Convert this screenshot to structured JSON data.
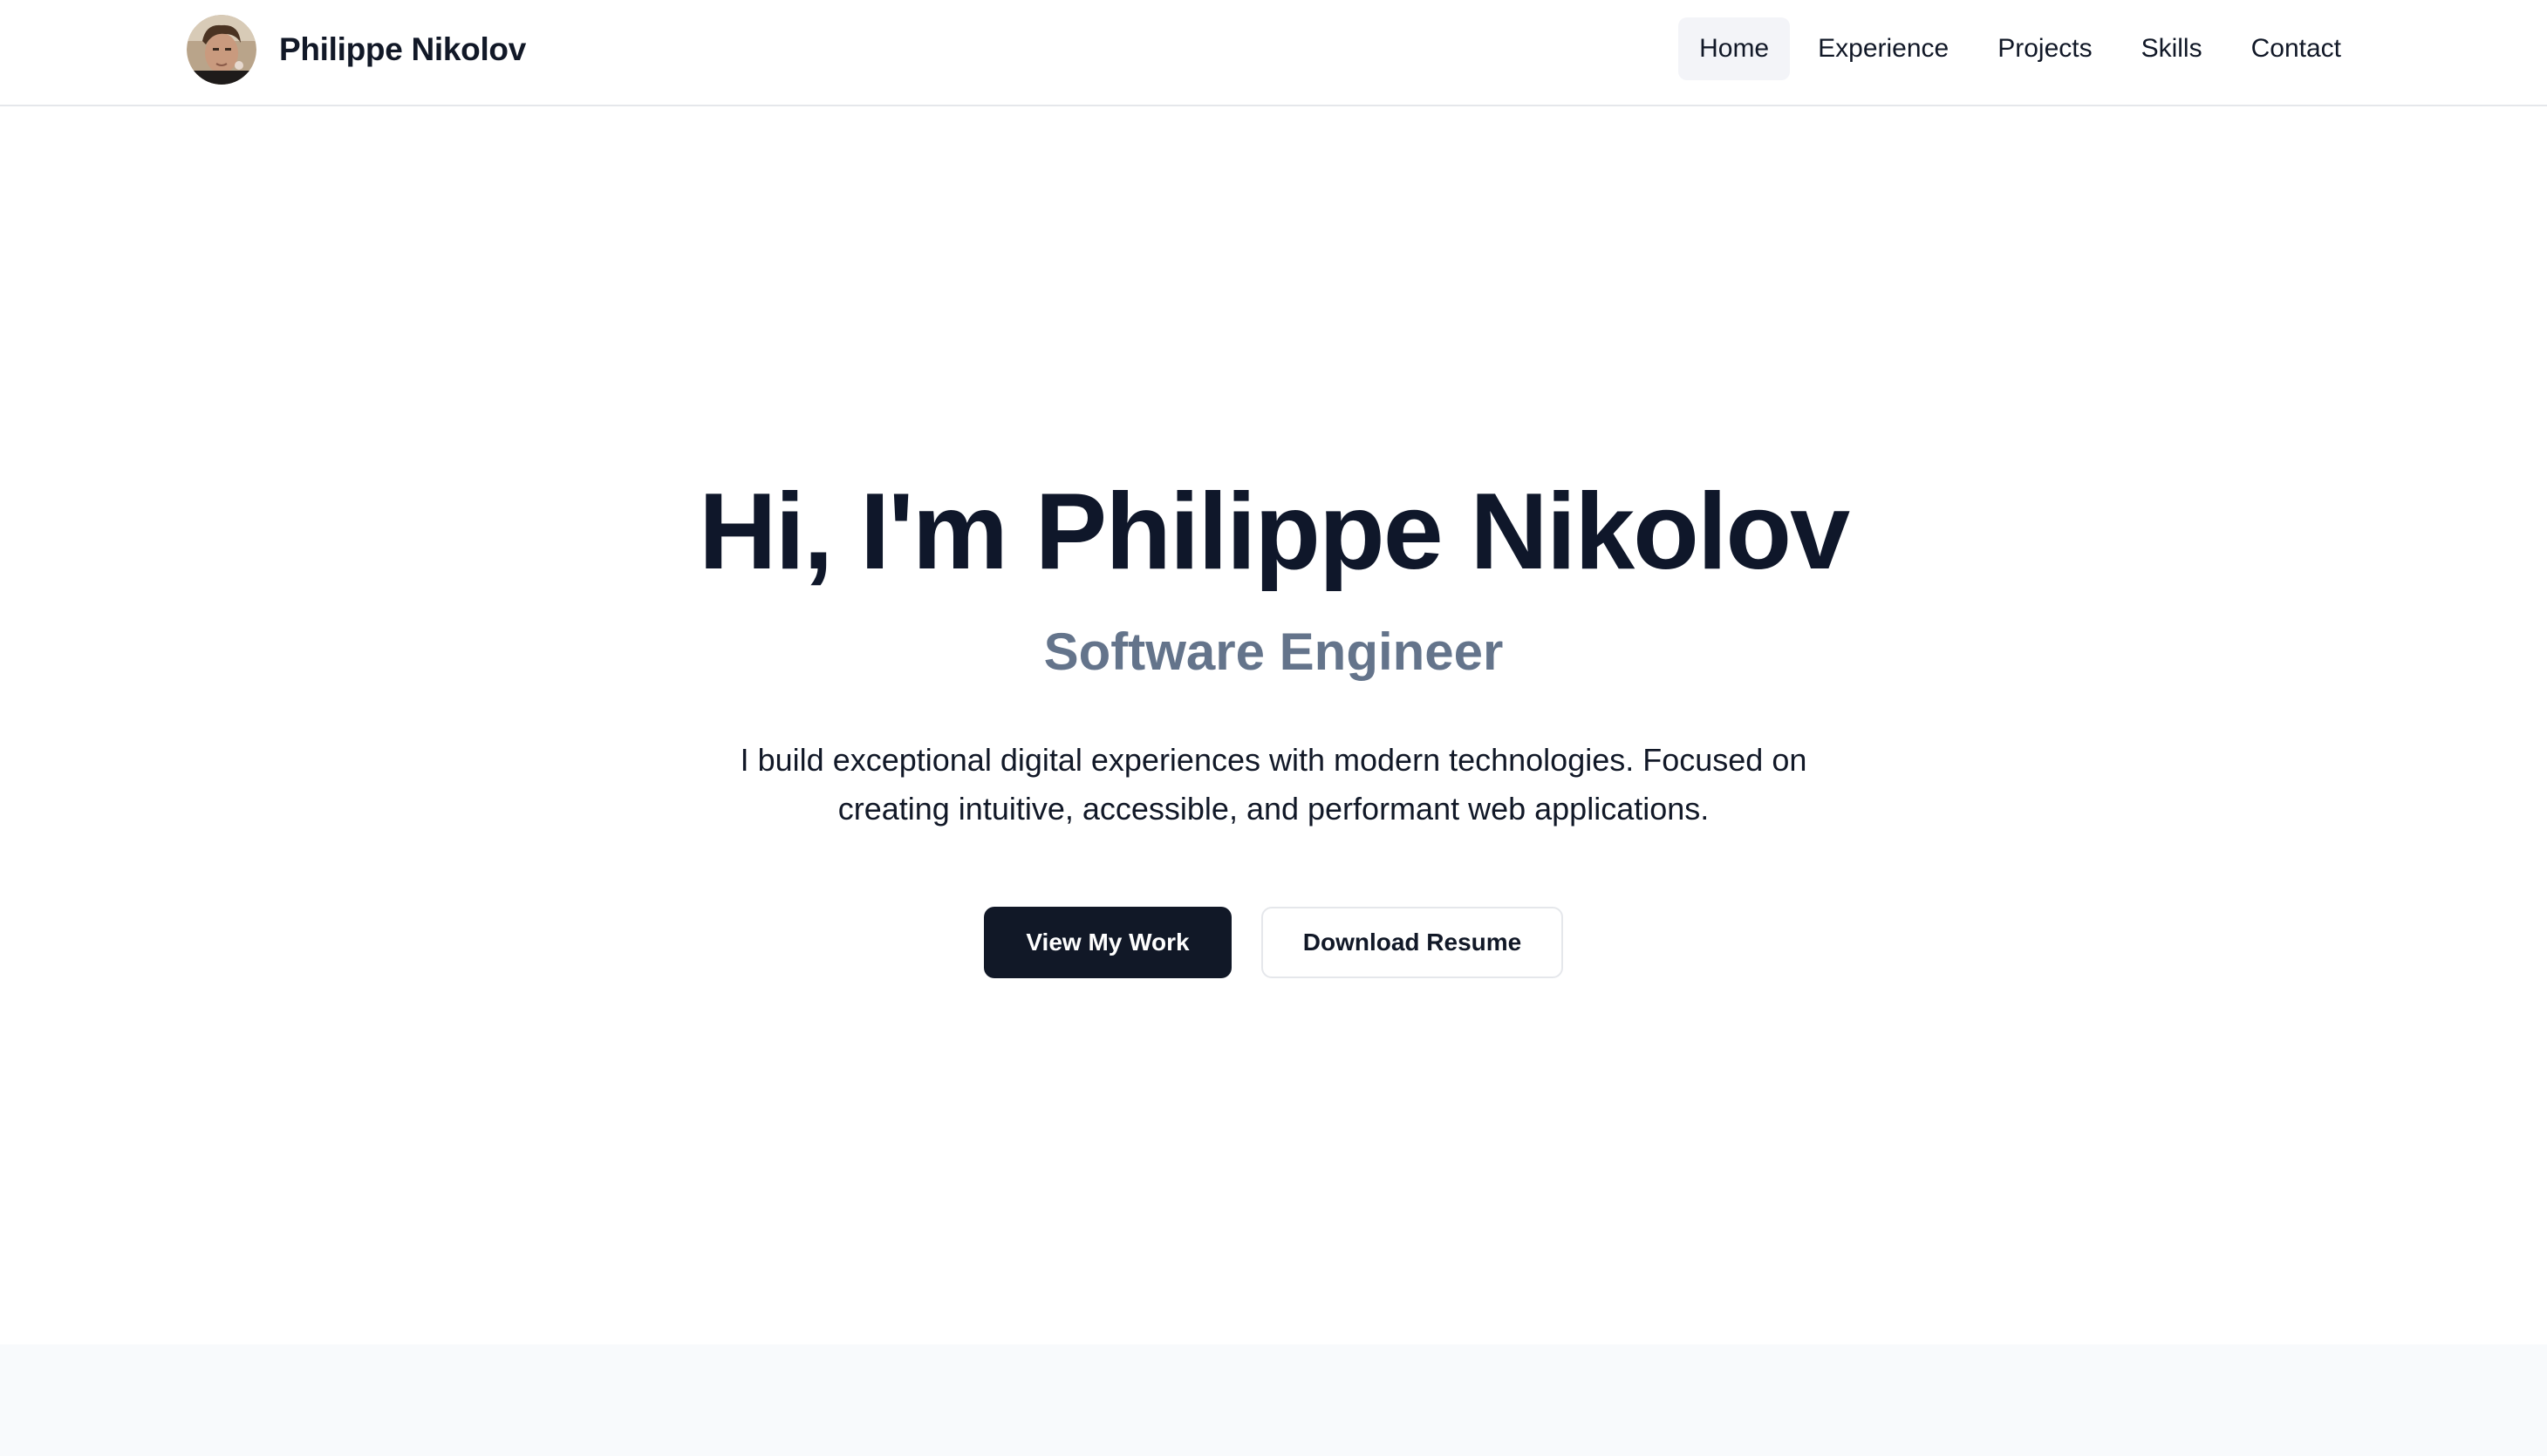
{
  "header": {
    "brand_name": "Philippe Nikolov",
    "avatar_icon": "profile-photo",
    "nav": [
      {
        "label": "Home",
        "active": true
      },
      {
        "label": "Experience",
        "active": false
      },
      {
        "label": "Projects",
        "active": false
      },
      {
        "label": "Skills",
        "active": false
      },
      {
        "label": "Contact",
        "active": false
      }
    ]
  },
  "hero": {
    "title": "Hi, I'm Philippe Nikolov",
    "subtitle": "Software Engineer",
    "description": "I build exceptional digital experiences with modern technologies. Focused on creating intuitive, accessible, and performant web applications.",
    "primary_button": "View My Work",
    "secondary_button": "Download Resume"
  },
  "colors": {
    "primary": "#111827",
    "subtitle": "#64748b",
    "active_nav_bg": "#f3f4f8",
    "section_bg": "#f8fafc"
  }
}
